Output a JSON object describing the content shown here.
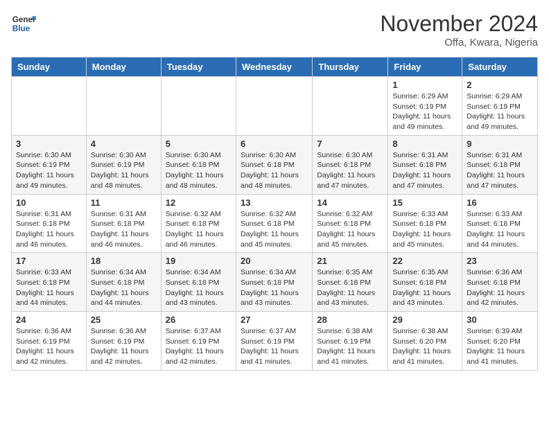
{
  "header": {
    "logo_general": "General",
    "logo_blue": "Blue",
    "month_title": "November 2024",
    "location": "Offa, Kwara, Nigeria"
  },
  "days_of_week": [
    "Sunday",
    "Monday",
    "Tuesday",
    "Wednesday",
    "Thursday",
    "Friday",
    "Saturday"
  ],
  "weeks": [
    [
      {
        "day": "",
        "info": ""
      },
      {
        "day": "",
        "info": ""
      },
      {
        "day": "",
        "info": ""
      },
      {
        "day": "",
        "info": ""
      },
      {
        "day": "",
        "info": ""
      },
      {
        "day": "1",
        "info": "Sunrise: 6:29 AM\nSunset: 6:19 PM\nDaylight: 11 hours and 49 minutes."
      },
      {
        "day": "2",
        "info": "Sunrise: 6:29 AM\nSunset: 6:19 PM\nDaylight: 11 hours and 49 minutes."
      }
    ],
    [
      {
        "day": "3",
        "info": "Sunrise: 6:30 AM\nSunset: 6:19 PM\nDaylight: 11 hours and 49 minutes."
      },
      {
        "day": "4",
        "info": "Sunrise: 6:30 AM\nSunset: 6:19 PM\nDaylight: 11 hours and 48 minutes."
      },
      {
        "day": "5",
        "info": "Sunrise: 6:30 AM\nSunset: 6:18 PM\nDaylight: 11 hours and 48 minutes."
      },
      {
        "day": "6",
        "info": "Sunrise: 6:30 AM\nSunset: 6:18 PM\nDaylight: 11 hours and 48 minutes."
      },
      {
        "day": "7",
        "info": "Sunrise: 6:30 AM\nSunset: 6:18 PM\nDaylight: 11 hours and 47 minutes."
      },
      {
        "day": "8",
        "info": "Sunrise: 6:31 AM\nSunset: 6:18 PM\nDaylight: 11 hours and 47 minutes."
      },
      {
        "day": "9",
        "info": "Sunrise: 6:31 AM\nSunset: 6:18 PM\nDaylight: 11 hours and 47 minutes."
      }
    ],
    [
      {
        "day": "10",
        "info": "Sunrise: 6:31 AM\nSunset: 6:18 PM\nDaylight: 11 hours and 46 minutes."
      },
      {
        "day": "11",
        "info": "Sunrise: 6:31 AM\nSunset: 6:18 PM\nDaylight: 11 hours and 46 minutes."
      },
      {
        "day": "12",
        "info": "Sunrise: 6:32 AM\nSunset: 6:18 PM\nDaylight: 11 hours and 46 minutes."
      },
      {
        "day": "13",
        "info": "Sunrise: 6:32 AM\nSunset: 6:18 PM\nDaylight: 11 hours and 45 minutes."
      },
      {
        "day": "14",
        "info": "Sunrise: 6:32 AM\nSunset: 6:18 PM\nDaylight: 11 hours and 45 minutes."
      },
      {
        "day": "15",
        "info": "Sunrise: 6:33 AM\nSunset: 6:18 PM\nDaylight: 11 hours and 45 minutes."
      },
      {
        "day": "16",
        "info": "Sunrise: 6:33 AM\nSunset: 6:18 PM\nDaylight: 11 hours and 44 minutes."
      }
    ],
    [
      {
        "day": "17",
        "info": "Sunrise: 6:33 AM\nSunset: 6:18 PM\nDaylight: 11 hours and 44 minutes."
      },
      {
        "day": "18",
        "info": "Sunrise: 6:34 AM\nSunset: 6:18 PM\nDaylight: 11 hours and 44 minutes."
      },
      {
        "day": "19",
        "info": "Sunrise: 6:34 AM\nSunset: 6:18 PM\nDaylight: 11 hours and 43 minutes."
      },
      {
        "day": "20",
        "info": "Sunrise: 6:34 AM\nSunset: 6:18 PM\nDaylight: 11 hours and 43 minutes."
      },
      {
        "day": "21",
        "info": "Sunrise: 6:35 AM\nSunset: 6:18 PM\nDaylight: 11 hours and 43 minutes."
      },
      {
        "day": "22",
        "info": "Sunrise: 6:35 AM\nSunset: 6:18 PM\nDaylight: 11 hours and 43 minutes."
      },
      {
        "day": "23",
        "info": "Sunrise: 6:36 AM\nSunset: 6:18 PM\nDaylight: 11 hours and 42 minutes."
      }
    ],
    [
      {
        "day": "24",
        "info": "Sunrise: 6:36 AM\nSunset: 6:19 PM\nDaylight: 11 hours and 42 minutes."
      },
      {
        "day": "25",
        "info": "Sunrise: 6:36 AM\nSunset: 6:19 PM\nDaylight: 11 hours and 42 minutes."
      },
      {
        "day": "26",
        "info": "Sunrise: 6:37 AM\nSunset: 6:19 PM\nDaylight: 11 hours and 42 minutes."
      },
      {
        "day": "27",
        "info": "Sunrise: 6:37 AM\nSunset: 6:19 PM\nDaylight: 11 hours and 41 minutes."
      },
      {
        "day": "28",
        "info": "Sunrise: 6:38 AM\nSunset: 6:19 PM\nDaylight: 11 hours and 41 minutes."
      },
      {
        "day": "29",
        "info": "Sunrise: 6:38 AM\nSunset: 6:20 PM\nDaylight: 11 hours and 41 minutes."
      },
      {
        "day": "30",
        "info": "Sunrise: 6:39 AM\nSunset: 6:20 PM\nDaylight: 11 hours and 41 minutes."
      }
    ]
  ]
}
